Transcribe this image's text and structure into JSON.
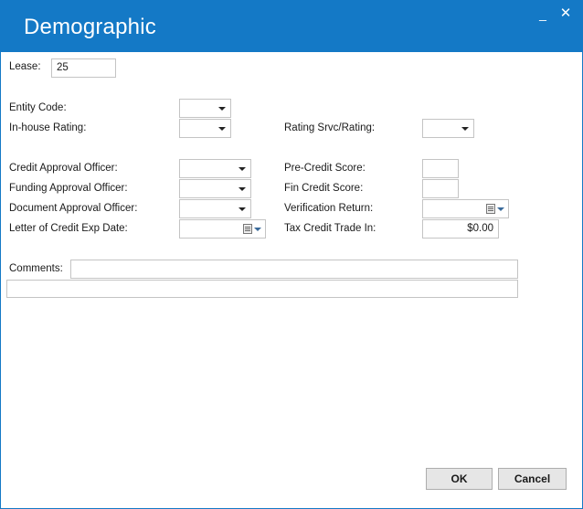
{
  "window": {
    "title": "Demographic",
    "minimize_glyph": "_",
    "close_glyph": "✕"
  },
  "lease": {
    "label": "Lease:",
    "value": "25"
  },
  "labels": {
    "entity_code": "Entity Code:",
    "inhouse_rating": "In-house Rating:",
    "rating_srvc": "Rating Srvc/Rating:",
    "credit_approval_officer": "Credit Approval Officer:",
    "funding_approval_officer": "Funding Approval Officer:",
    "document_approval_officer": "Document Approval Officer:",
    "letter_of_credit_exp_date": "Letter of Credit Exp Date:",
    "pre_credit_score": "Pre-Credit Score:",
    "fin_credit_score": "Fin Credit Score:",
    "verification_return": "Verification Return:",
    "tax_credit_trade_in": "Tax Credit Trade In:",
    "comments": "Comments:"
  },
  "values": {
    "entity_code": "",
    "inhouse_rating": "",
    "rating_srvc": "",
    "credit_approval_officer": "",
    "funding_approval_officer": "",
    "document_approval_officer": "",
    "letter_of_credit_exp_date": "",
    "pre_credit_score": "",
    "fin_credit_score": "",
    "verification_return": "",
    "tax_credit_trade_in": "$0.00",
    "comments": ""
  },
  "buttons": {
    "ok": "OK",
    "cancel": "Cancel"
  },
  "colors": {
    "titlebar": "#1479c6",
    "button_bg": "#e6e6e6",
    "field_border": "#c4c4c4"
  }
}
